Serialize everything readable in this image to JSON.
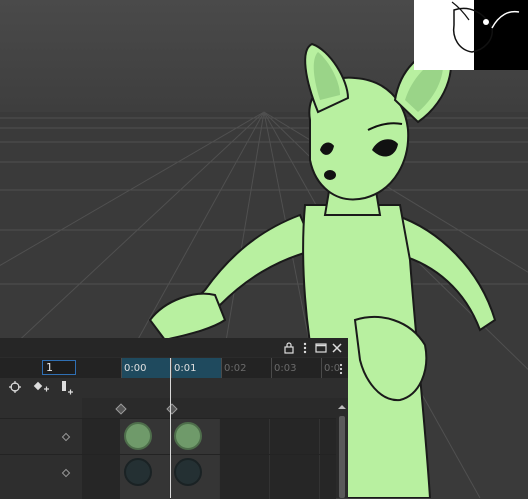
{
  "timeline": {
    "frame_value": "1",
    "ruler_labels": [
      "0:00",
      "0:01",
      "0:02",
      "0:03",
      "0:0"
    ],
    "header_icons": [
      "lock-icon",
      "more-vertical-icon",
      "maximize-icon",
      "close-icon"
    ],
    "tool_icons": [
      "crosshair-icon",
      "add-key-icon",
      "add-track-icon"
    ],
    "key_colors": {
      "row1": "#6f9a6a",
      "row2": "#243033"
    }
  },
  "colors": {
    "accent": "#2f6fb3",
    "character": "#b8f0a0",
    "panel_bg": "#2b2b2b",
    "ruler_range": "#1f4a5e"
  }
}
